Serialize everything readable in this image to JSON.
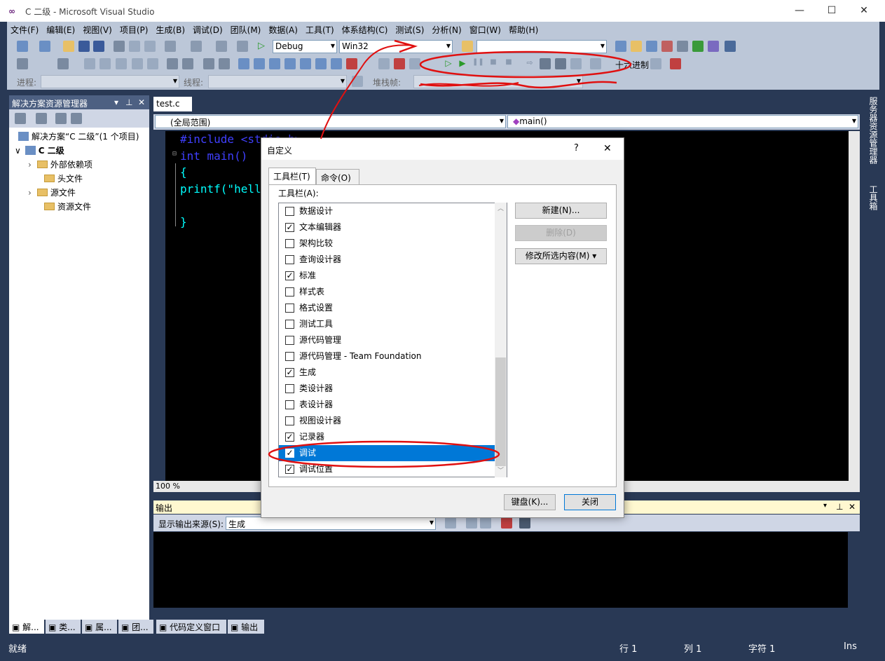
{
  "window": {
    "title": "C 二级 - Microsoft Visual Studio",
    "minimize": "—",
    "maximize": "☐",
    "close": "✕"
  },
  "menu": [
    "文件(F)",
    "编辑(E)",
    "视图(V)",
    "项目(P)",
    "生成(B)",
    "调试(D)",
    "团队(M)",
    "数据(A)",
    "工具(T)",
    "体系结构(C)",
    "测试(S)",
    "分析(N)",
    "窗口(W)",
    "帮助(H)"
  ],
  "toolbar": {
    "config": "Debug",
    "platform": "Win32",
    "find_combo": "",
    "hex_label": "十六进制",
    "process_label": "进程:",
    "thread_label": "线程:",
    "stack_label": "堆栈帧:"
  },
  "solution_explorer": {
    "header": "解决方案资源管理器",
    "header_buttons": [
      "▾",
      "⊥",
      "✕"
    ],
    "solution": "解决方案“C 二级”(1 个项目)",
    "project": "C 二级",
    "items": [
      "外部依赖项",
      "头文件",
      "源文件",
      "资源文件"
    ]
  },
  "bottom_tabs": [
    "解...",
    "类...",
    "属...",
    "团...",
    "代码定义窗口",
    "输出"
  ],
  "status": {
    "left": "就绪",
    "row": "行 1",
    "col": "列 1",
    "char": "字符 1",
    "mode": "Ins"
  },
  "editor": {
    "tab": "test.c",
    "scope": "(全局范围)",
    "function": "main()",
    "zoom": "100 %",
    "code_lines": [
      {
        "text": "#include <stdio.h>",
        "color": "#4040ff"
      },
      {
        "text": "int main()",
        "color": "#4040ff"
      },
      {
        "text": "{",
        "color": "#00ffff"
      },
      {
        "text": "printf(\"hell",
        "color": "#00ffff"
      },
      {
        "text": "",
        "color": "#00ffff"
      },
      {
        "text": "}",
        "color": "#00ffff"
      }
    ]
  },
  "output": {
    "header": "输出",
    "source_label": "显示输出来源(S):",
    "source_value": "生成"
  },
  "right_sidebar": [
    "服务器资源管理器",
    "工具箱"
  ],
  "dialog": {
    "title": "自定义",
    "help": "?",
    "close": "✕",
    "tabs": [
      "工具栏(T)",
      "命令(O)"
    ],
    "list_label": "工具栏(A):",
    "toolbars": [
      {
        "label": "数据设计",
        "checked": false
      },
      {
        "label": "文本编辑器",
        "checked": true
      },
      {
        "label": "架构比较",
        "checked": false
      },
      {
        "label": "查询设计器",
        "checked": false
      },
      {
        "label": "标准",
        "checked": true
      },
      {
        "label": "样式表",
        "checked": false
      },
      {
        "label": "格式设置",
        "checked": false
      },
      {
        "label": "测试工具",
        "checked": false
      },
      {
        "label": "源代码管理",
        "checked": false
      },
      {
        "label": "源代码管理 - Team Foundation",
        "checked": false
      },
      {
        "label": "生成",
        "checked": true
      },
      {
        "label": "类设计器",
        "checked": false
      },
      {
        "label": "表设计器",
        "checked": false
      },
      {
        "label": "视图设计器",
        "checked": false
      },
      {
        "label": "记录器",
        "checked": true
      },
      {
        "label": "调试",
        "checked": true,
        "selected": true
      },
      {
        "label": "调试位置",
        "checked": true
      }
    ],
    "buttons": {
      "new": "新建(N)...",
      "delete": "删除(D)",
      "modify": "修改所选内容(M) ▾",
      "keyboard": "键盘(K)...",
      "close": "关闭"
    }
  },
  "colors": {
    "vs_bg": "#293955",
    "toolbar": "#bcc7d8",
    "selection": "#0078d7",
    "annotation": "#e01010"
  }
}
